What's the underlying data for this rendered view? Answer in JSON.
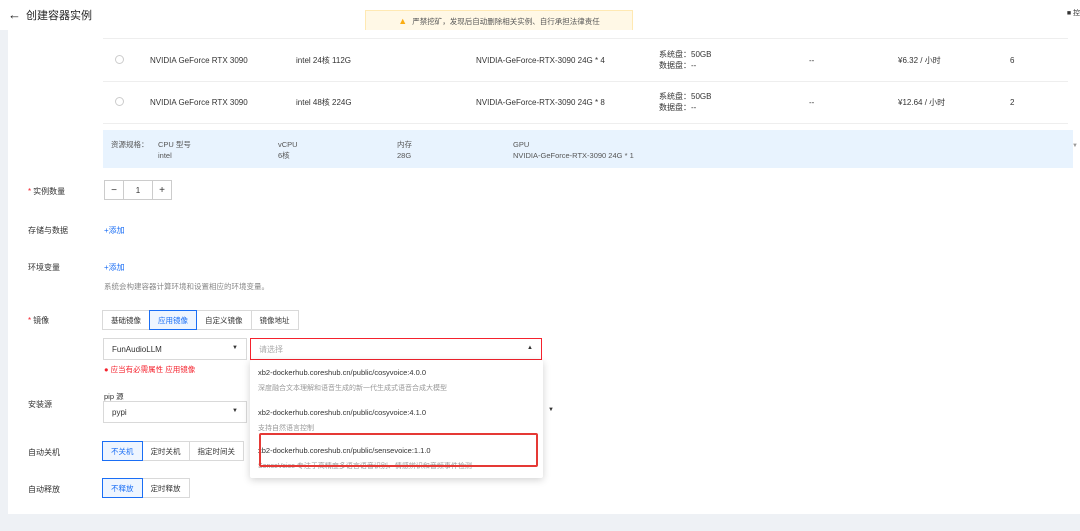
{
  "header": {
    "back_arrow": "←",
    "title": "创建容器实例",
    "warning": "严禁挖矿，发现后自动删除相关实例、自行承担法律责任",
    "right_text": "■ 控"
  },
  "gpu_rows": [
    {
      "name": "NVIDIA GeForce RTX 3090",
      "cpu": "intel 24核 112G",
      "gpu": "NVIDIA-GeForce-RTX-3090 24G * 4",
      "sys_disk": "系统盘：50GB",
      "data_disk": "数据盘：--",
      "other": "--",
      "price": "¥6.32 / 小时",
      "count": "6"
    },
    {
      "name": "NVIDIA GeForce RTX 3090",
      "cpu": "intel 48核 224G",
      "gpu": "NVIDIA-GeForce-RTX-3090 24G * 8",
      "sys_disk": "系统盘：50GB",
      "data_disk": "数据盘：--",
      "other": "--",
      "price": "¥12.64 / 小时",
      "count": "2"
    }
  ],
  "spec": {
    "label": "资源规格：",
    "cpu_model_label": "CPU 型号",
    "cpu_model": "intel",
    "vcpu_label": "vCPU",
    "vcpu": "6核",
    "mem_label": "内存",
    "mem": "28G",
    "gpu_label": "GPU",
    "gpu": "NVIDIA-GeForce-RTX-3090 24G * 1"
  },
  "form": {
    "req_mark": "*",
    "instances_label": "实例数量",
    "minus": "−",
    "instances_value": "1",
    "plus": "+",
    "storage_label": "存储与数据",
    "storage_add": "+添加",
    "env_label": "环境变量",
    "env_add": "+添加",
    "env_hint": "系统会构建容器计算环境和设置相应的环境变量。",
    "image_label": "镜像",
    "image_tabs": [
      "基础镜像",
      "应用镜像",
      "自定义镜像",
      "镜像地址"
    ],
    "image_active_tab": 1,
    "image_category": "FunAudioLLM",
    "image_placeholder": "请选择",
    "error_icon": "●",
    "error_msg": "应当有必需属性 应用镜像",
    "install_label": "安装源",
    "pip_label": "pip 源",
    "pip_value": "pypi",
    "shutdown_label": "自动关机",
    "shutdown_opts": [
      "不关机",
      "定时关机",
      "指定时间关"
    ],
    "release_label": "自动释放",
    "release_opts": [
      "不释放",
      "定时释放"
    ]
  },
  "dropdown": [
    {
      "name": "xb2-dockerhub.coreshub.cn/public/cosyvoice:4.0.0",
      "desc": "深度融合文本理解和语音生成的新一代生成式语音合成大模型"
    },
    {
      "name": "xb2-dockerhub.coreshub.cn/public/cosyvoice:4.1.0",
      "desc": "支持自然语言控制"
    },
    {
      "name": "xb2-dockerhub.coreshub.cn/public/sensevoice:1.1.0",
      "desc": "SenseVoice 专注于高精度多语言语音识别、情感辨识和音频事件检测"
    }
  ],
  "colors": {
    "accent": "#1a6ef5",
    "error": "#f5222d",
    "highlight": "#e53935"
  }
}
